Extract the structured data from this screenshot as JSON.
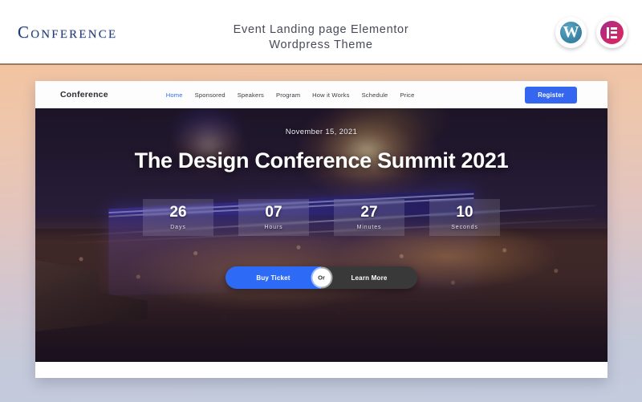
{
  "banner": {
    "logo": "Conference",
    "title_line1": "Event Landing page Elementor",
    "title_line2": "Wordpress Theme",
    "icons": [
      {
        "name": "wordpress-icon",
        "glyph": "W"
      },
      {
        "name": "elementor-icon",
        "glyph": "E"
      }
    ],
    "accent_rule_color": "#9c7b5e"
  },
  "site": {
    "nav": {
      "brand": "Conference",
      "items": [
        {
          "label": "Home",
          "active": true
        },
        {
          "label": "Sponsored",
          "active": false
        },
        {
          "label": "Speakers",
          "active": false
        },
        {
          "label": "Program",
          "active": false
        },
        {
          "label": "How it Works",
          "active": false
        },
        {
          "label": "Schedule",
          "active": false
        },
        {
          "label": "Price",
          "active": false
        }
      ],
      "register_label": "Register",
      "register_color": "#3566ef",
      "active_link_color": "#2f6df0"
    },
    "hero": {
      "date": "November 15, 2021",
      "title": "The Design Conference Summit 2021",
      "countdown": [
        {
          "value": "26",
          "label": "Days"
        },
        {
          "value": "07",
          "label": "Hours"
        },
        {
          "value": "27",
          "label": "Minutes"
        },
        {
          "value": "10",
          "label": "Seconds"
        }
      ],
      "cta": {
        "primary_label": "Buy Ticket",
        "divider_label": "Or",
        "secondary_label": "Learn More",
        "primary_color": "#2d6bf6",
        "secondary_color": "#393939"
      }
    }
  },
  "background": {
    "gradient_top": "#f2c4a1",
    "gradient_bottom": "#c3cbdd"
  }
}
